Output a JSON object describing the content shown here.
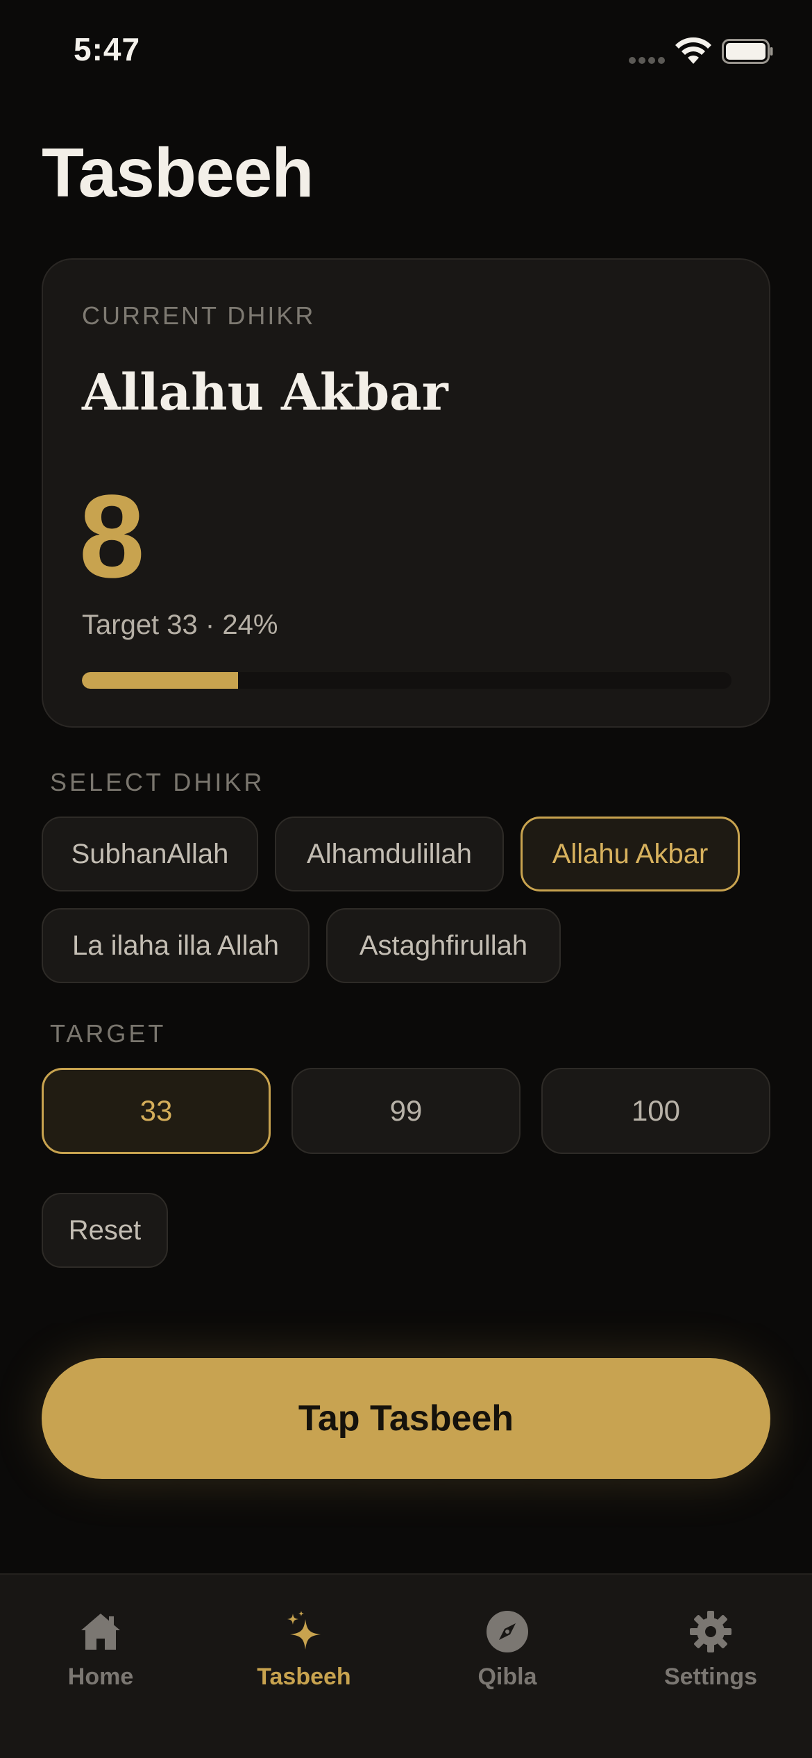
{
  "status_bar": {
    "time": "5:47"
  },
  "page": {
    "title": "Tasbeeh"
  },
  "current_card": {
    "label": "CURRENT DHIKR",
    "dhikr": "Allahu Akbar",
    "count": "8",
    "target_text": "Target 33 · 24%",
    "progress_fraction": 0.24
  },
  "select_dhikr": {
    "label": "SELECT DHIKR",
    "options": [
      {
        "label": "SubhanAllah",
        "selected": false
      },
      {
        "label": "Alhamdulillah",
        "selected": false
      },
      {
        "label": "Allahu Akbar",
        "selected": true
      },
      {
        "label": "La ilaha illa Allah",
        "selected": false
      },
      {
        "label": "Astaghfirullah",
        "selected": false
      }
    ]
  },
  "target": {
    "label": "TARGET",
    "options": [
      {
        "label": "33",
        "selected": true
      },
      {
        "label": "99",
        "selected": false
      },
      {
        "label": "100",
        "selected": false
      }
    ]
  },
  "reset_label": "Reset",
  "tap_button_label": "Tap Tasbeeh",
  "tabbar": {
    "tabs": [
      {
        "label": "Home",
        "icon": "home-icon",
        "active": false
      },
      {
        "label": "Tasbeeh",
        "icon": "sparkle-icon",
        "active": true
      },
      {
        "label": "Qibla",
        "icon": "compass-icon",
        "active": false
      },
      {
        "label": "Settings",
        "icon": "gear-icon",
        "active": false
      }
    ]
  },
  "colors": {
    "accent": "#c8a34f",
    "background": "#0b0a09",
    "card": "#191715",
    "inactive": "#7b7772"
  }
}
